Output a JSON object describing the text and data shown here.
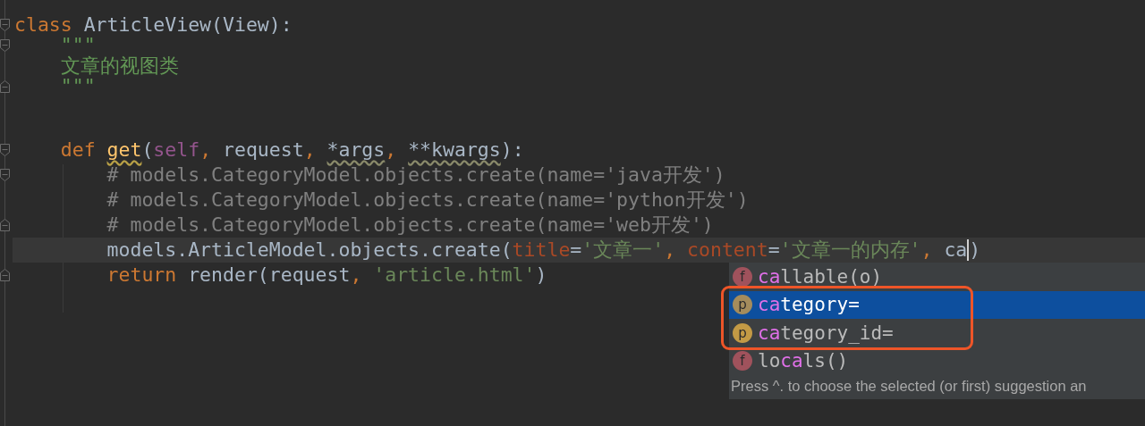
{
  "editor": {
    "lines": [
      {
        "kind": "fold-start",
        "current": false,
        "tokens": [
          {
            "kind": "keyword",
            "text": "class "
          },
          {
            "kind": "plain",
            "text": "ArticleView(View):"
          }
        ]
      },
      {
        "kind": "fold-start",
        "current": false,
        "tokens": [
          {
            "kind": "docstring",
            "text": "    \"\"\""
          }
        ]
      },
      {
        "kind": "plain",
        "current": false,
        "tokens": [
          {
            "kind": "docstring",
            "text": "    文章的视图类"
          }
        ]
      },
      {
        "kind": "fold-end",
        "current": false,
        "tokens": [
          {
            "kind": "docstring",
            "text": "    \"\"\""
          }
        ]
      },
      {
        "kind": "plain"
      },
      {
        "kind": "plain"
      },
      {
        "kind": "fold-start",
        "current": false,
        "tokens": [
          {
            "kind": "keyword",
            "text": "    def "
          },
          {
            "kind": "function-warning",
            "text": "get"
          },
          {
            "kind": "plain",
            "text": "("
          },
          {
            "kind": "self",
            "text": "self"
          },
          {
            "kind": "keyword",
            "text": ", "
          },
          {
            "kind": "plain",
            "text": "request"
          },
          {
            "kind": "keyword",
            "text": ", "
          },
          {
            "kind": "plain-warning",
            "text": "*args"
          },
          {
            "kind": "keyword",
            "text": ", "
          },
          {
            "kind": "plain-warning",
            "text": "**kwargs"
          },
          {
            "kind": "plain",
            "text": "):"
          }
        ]
      },
      {
        "kind": "fold-start",
        "current": false,
        "tokens": [
          {
            "kind": "comment",
            "text": "        # models.CategoryModel.objects.create(name='java开发')"
          }
        ]
      },
      {
        "kind": "plain",
        "current": false,
        "tokens": [
          {
            "kind": "comment",
            "text": "        # models.CategoryModel.objects.create(name='python开发')"
          }
        ]
      },
      {
        "kind": "fold-end",
        "current": false,
        "tokens": [
          {
            "kind": "comment",
            "text": "        # models.CategoryModel.objects.create(name='web开发')"
          }
        ]
      },
      {
        "kind": "plain",
        "current": true,
        "tokens": [
          {
            "kind": "plain",
            "text": "        models.ArticleModel.objects.create("
          },
          {
            "kind": "named-arg",
            "text": "title"
          },
          {
            "kind": "plain",
            "text": "="
          },
          {
            "kind": "string",
            "text": "'文章一'"
          },
          {
            "kind": "keyword",
            "text": ", "
          },
          {
            "kind": "named-arg",
            "text": "content"
          },
          {
            "kind": "plain",
            "text": "="
          },
          {
            "kind": "string",
            "text": "'文章一的内存'"
          },
          {
            "kind": "keyword",
            "text": ", "
          },
          {
            "kind": "typed",
            "text": "ca"
          },
          {
            "kind": "plain",
            "text": ")"
          }
        ]
      },
      {
        "kind": "fold-end",
        "current": false,
        "tokens": [
          {
            "kind": "keyword",
            "text": "        return "
          },
          {
            "kind": "plain",
            "text": "render(request"
          },
          {
            "kind": "keyword",
            "text": ", "
          },
          {
            "kind": "string",
            "text": "'article.html'"
          },
          {
            "kind": "plain",
            "text": ")"
          }
        ]
      }
    ]
  },
  "completion": {
    "items": [
      {
        "icon": "f",
        "kind": "function",
        "match": "ca",
        "after": "llable(o)",
        "selected": false
      },
      {
        "icon": "p",
        "kind": "parameter",
        "match": "ca",
        "after": "tegory=",
        "selected": true
      },
      {
        "icon": "p",
        "kind": "parameter",
        "match": "ca",
        "after": "tegory_id=",
        "selected": false
      },
      {
        "icon": "f",
        "kind": "function",
        "before": "lo",
        "match": "ca",
        "after": "ls()",
        "selected": false
      }
    ],
    "hint": "Press ^. to choose the selected (or first) suggestion an"
  }
}
